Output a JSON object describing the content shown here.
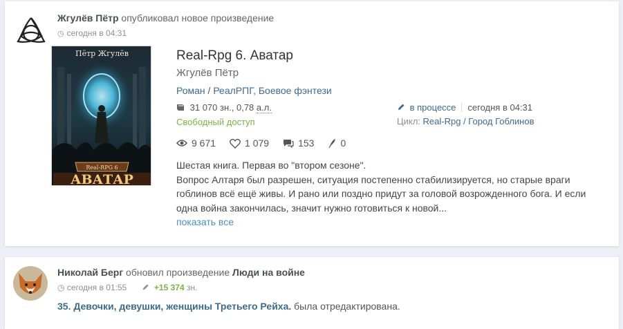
{
  "post1": {
    "author": "Жгулёв Пётр",
    "action": "опубликовал новое произведение",
    "time": "сегодня в 04:31",
    "cover": {
      "author": "Пётр Жгулёв",
      "series": "Real-RPG 6",
      "title": "АВАТАР"
    },
    "work": {
      "title": "Real-Rpg 6. Аватар",
      "author": "Жгулёв Пётр",
      "genre_main": "Роман",
      "genre_sep": "/",
      "genres": "РеалРПГ, Боевое фэнтези",
      "size_prefix": "31 070 зн., 0,78",
      "size_unit": "а.л.",
      "access": "Свободный доступ",
      "status": "в процессе",
      "status_time": "сегодня в 04:31",
      "cycle_label": "Цикл:",
      "cycle": "Real-Rpg / Город Гоблинов",
      "stats": {
        "views": "9 671",
        "likes": "1 079",
        "comments": "153",
        "awards": "0"
      },
      "description": [
        "Шестая книга. Первая во \"втором сезоне\".",
        "Вопрос Алтаря был разрешен, ситуация постепенно стабилизируется, но старые враги гоблинов всё ещё живы. И рано или поздно придут за головой возрожденного бога. И если одна война закончилась, значит нужно готовиться к новой..."
      ],
      "show_all": "показать все"
    }
  },
  "post2": {
    "author": "Николай Берг",
    "action": "обновил произведение",
    "work": "Люди на войне",
    "time": "сегодня в 01:55",
    "delta": "+15 374",
    "delta_unit": "зн.",
    "chapter": "35. Девочки, девушки, женщины Третьего Рейха.",
    "chapter_suffix": "была отредактирована."
  },
  "colors": {
    "link": "#3d6b8e",
    "green": "#7cb342",
    "show_all": "#4a90c2"
  }
}
